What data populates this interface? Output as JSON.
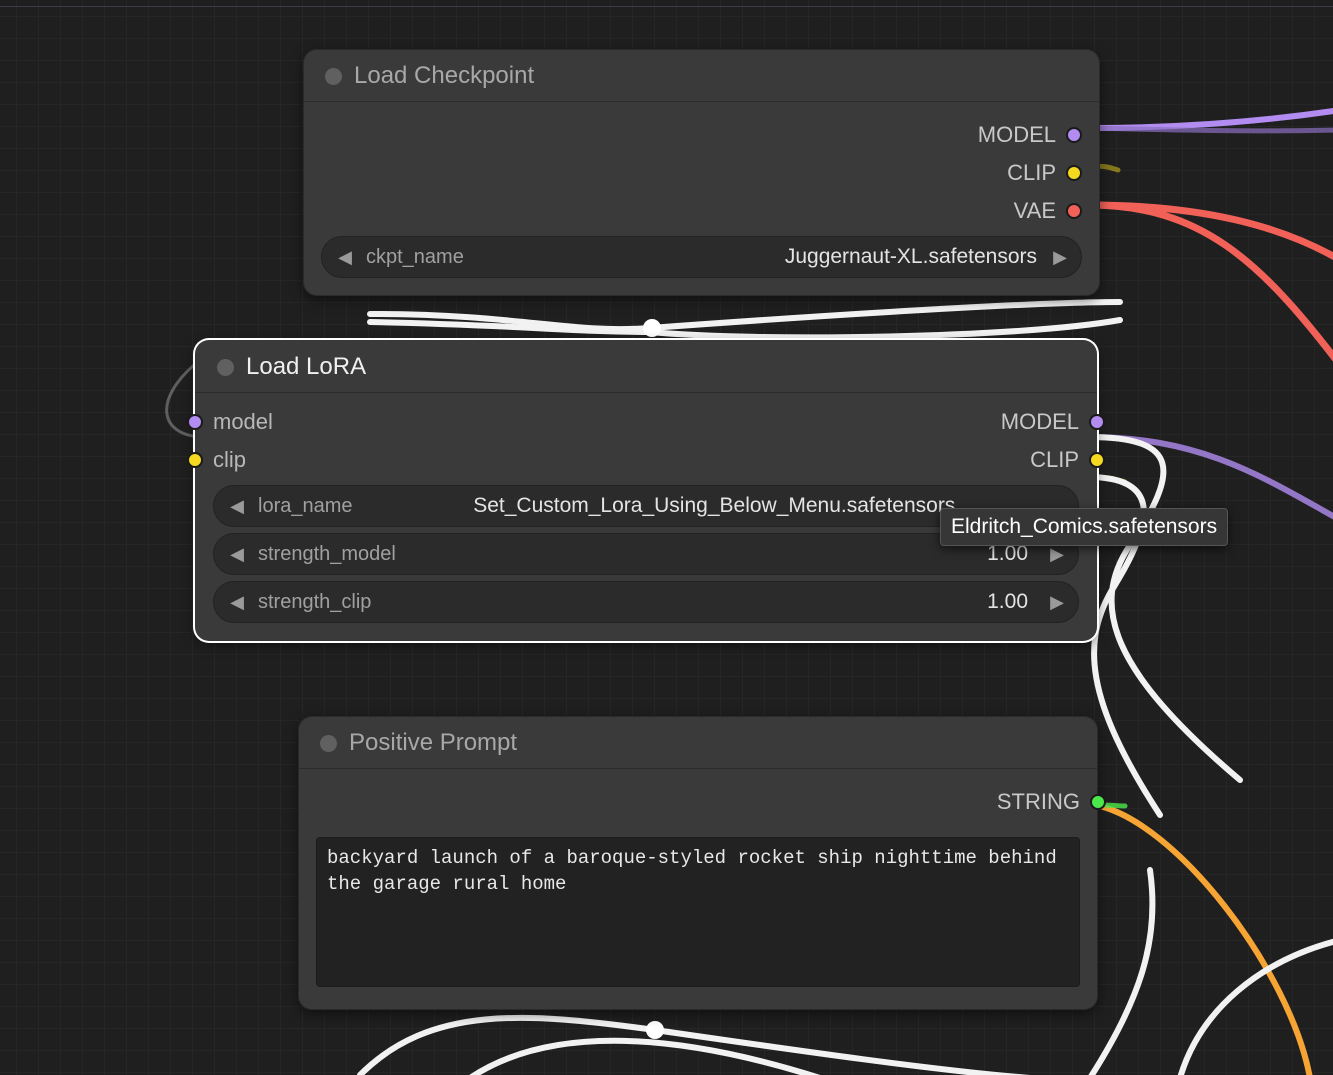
{
  "nodes": {
    "load_checkpoint": {
      "title": "Load Checkpoint",
      "outputs": {
        "model": "MODEL",
        "clip": "CLIP",
        "vae": "VAE"
      },
      "widgets": {
        "ckpt_name": {
          "label": "ckpt_name",
          "value": "Juggernaut-XL.safetensors"
        }
      }
    },
    "load_lora": {
      "title": "Load LoRA",
      "inputs": {
        "model": "model",
        "clip": "clip"
      },
      "outputs": {
        "model": "MODEL",
        "clip": "CLIP"
      },
      "widgets": {
        "lora_name": {
          "label": "lora_name",
          "value": "Set_Custom_Lora_Using_Below_Menu.safetensors"
        },
        "strength_model": {
          "label": "strength_model",
          "value": "1.00"
        },
        "strength_clip": {
          "label": "strength_clip",
          "value": "1.00"
        }
      }
    },
    "positive_prompt": {
      "title": "Positive Prompt",
      "outputs": {
        "string": "STRING"
      },
      "text": "backyard launch of a baroque-styled rocket ship nighttime behind the garage rural home"
    }
  },
  "tooltip": "Eldritch_Comics.safetensors",
  "colors": {
    "purple": "#b28cf0",
    "yellow": "#f5d820",
    "red": "#f26158",
    "green": "#4be84b",
    "white": "#f2f2f2",
    "orange": "#f6a534"
  }
}
